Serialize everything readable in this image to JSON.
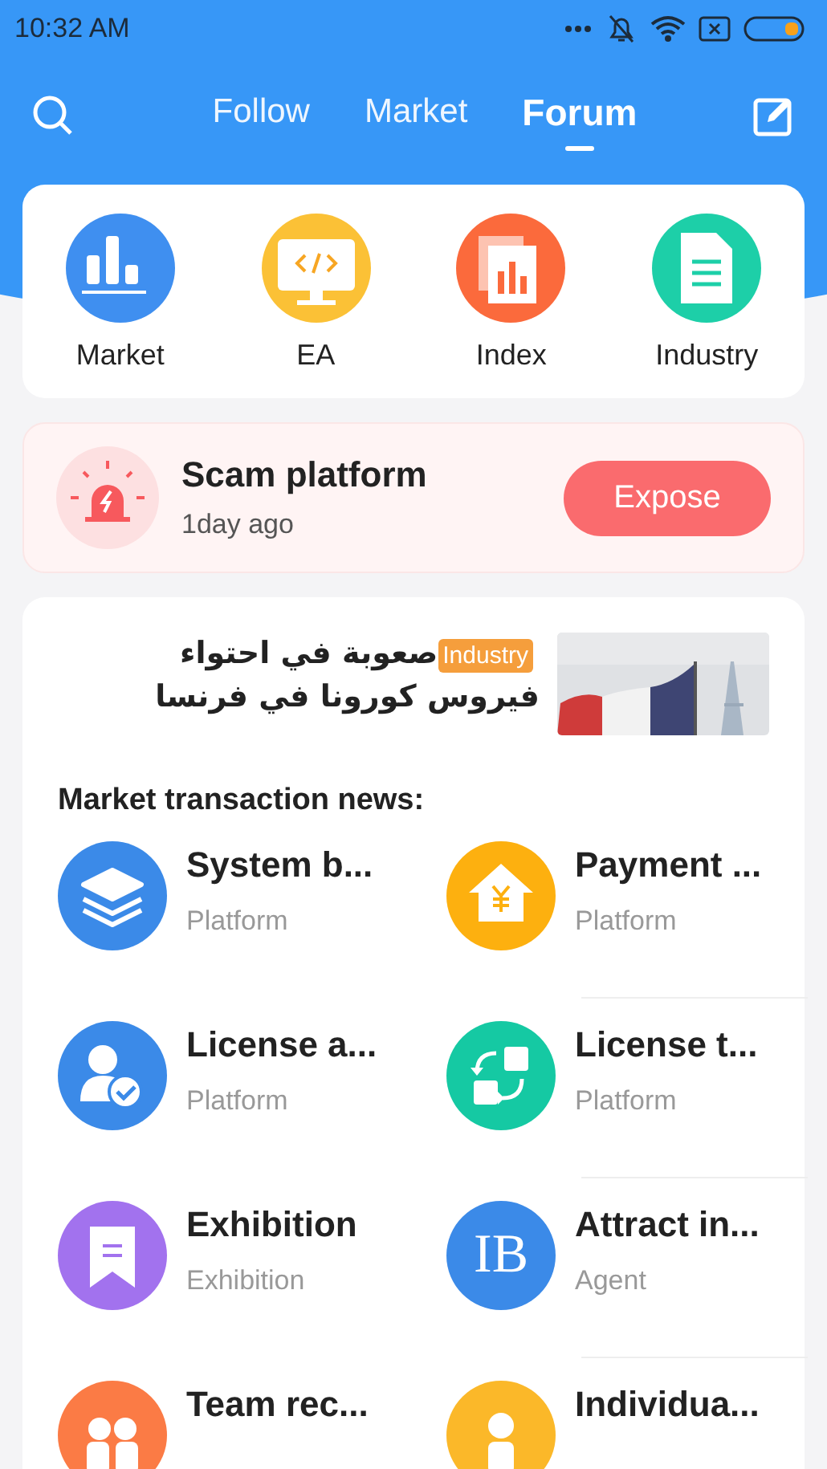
{
  "status_bar": {
    "time": "10:32  AM"
  },
  "header": {
    "tabs": [
      {
        "label": "Follow",
        "selected": false
      },
      {
        "label": "Market",
        "selected": false
      },
      {
        "label": "Forum",
        "selected": true
      }
    ]
  },
  "categories": [
    {
      "label": "Market",
      "kind": "bars"
    },
    {
      "label": "EA",
      "kind": "code"
    },
    {
      "label": "Index",
      "kind": "report"
    },
    {
      "label": "Industry",
      "kind": "document"
    }
  ],
  "alert": {
    "title": "Scam platform",
    "time": "1day ago",
    "button": "Expose"
  },
  "featured": {
    "tag": "Industry",
    "title": "صعوبة في احتواء فيروس كورونا في فرنسا"
  },
  "news": {
    "heading": "Market transaction news:",
    "items": [
      {
        "title": "System b...",
        "subtitle": "Platform",
        "kind": "layers"
      },
      {
        "title": "Payment ...",
        "subtitle": "Platform",
        "kind": "yen-house"
      },
      {
        "title": "License a...",
        "subtitle": "Platform",
        "kind": "user-check"
      },
      {
        "title": "License t...",
        "subtitle": "Platform",
        "kind": "swap"
      },
      {
        "title": "Exhibition",
        "subtitle": "Exhibition",
        "kind": "bookmark"
      },
      {
        "title": "Attract in...",
        "subtitle": "Agent",
        "kind": "text",
        "icon_text": "IB"
      },
      {
        "title": "Team rec...",
        "kind": "people"
      },
      {
        "title": "Individua...",
        "kind": "person"
      }
    ]
  }
}
